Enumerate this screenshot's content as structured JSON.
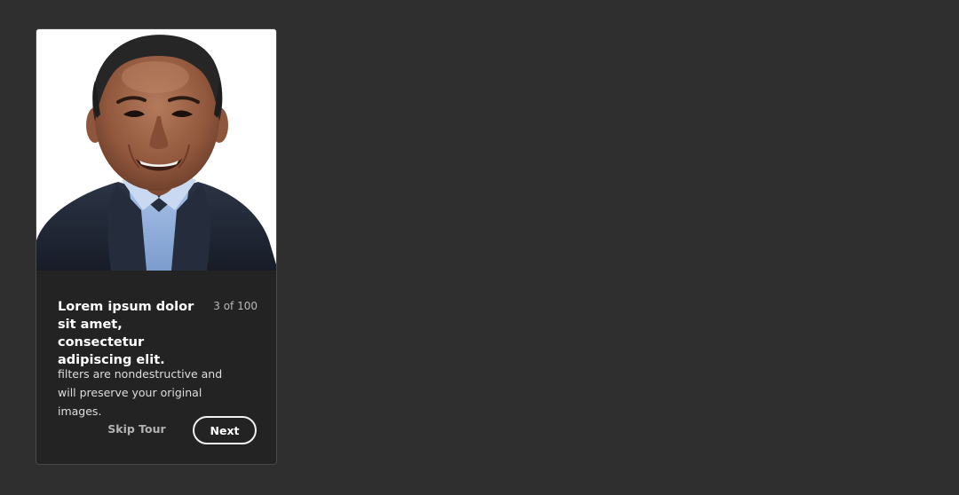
{
  "tour": {
    "title": "Lorem ipsum dolor sit amet, consectetur adipiscing elit.",
    "counter": "3 of 100",
    "description": "filters are nondestructive and will preserve your original images.",
    "skip_label": "Skip Tour",
    "next_label": "Next",
    "image_alt": "portrait photo of a smiling man in a dark suit jacket"
  },
  "colors": {
    "background": "#2f2f2f",
    "card": "#232323",
    "button_border": "#f1f1f1"
  }
}
